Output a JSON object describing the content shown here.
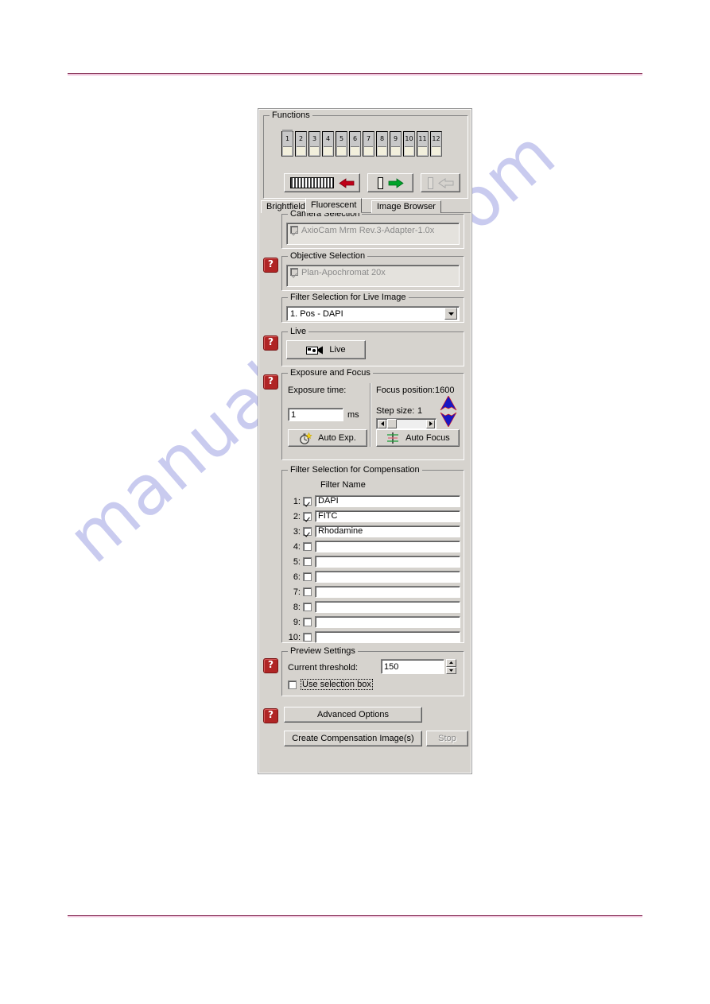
{
  "page": {
    "watermark": "manualshive.com",
    "rule_color": "#8c3a5e"
  },
  "window": {
    "functions": {
      "title": "Functions",
      "buttons": [
        "1",
        "2",
        "3",
        "4",
        "5",
        "6",
        "7",
        "8",
        "9",
        "10",
        "11",
        "12"
      ],
      "toolbar": [
        {
          "name": "load-rack-button",
          "icon": "rack-with-red-left-arrow",
          "enabled": true
        },
        {
          "name": "load-slide-button",
          "icon": "slide-with-green-right-arrow",
          "enabled": true
        },
        {
          "name": "unload-slide-button",
          "icon": "slide-with-gray-left-arrow",
          "enabled": false
        }
      ]
    },
    "tabs": [
      {
        "label": "Brightfield",
        "active": false
      },
      {
        "label": "Fluorescent",
        "active": true
      },
      {
        "label": "Image Browser",
        "active": false
      }
    ],
    "camera_selection": {
      "title": "Camera Selection",
      "item": "AxioCam Mrm Rev.3-Adapter-1.0x",
      "checked": true,
      "enabled": false
    },
    "objective_selection": {
      "title": "Objective Selection",
      "item": "Plan-Apochromat 20x",
      "checked": true,
      "enabled": false
    },
    "filter_live": {
      "title": "Filter Selection for Live Image",
      "value": "1. Pos - DAPI"
    },
    "live": {
      "title": "Live",
      "button_label": "Live",
      "button_icon": "video-camera-icon"
    },
    "exposure_focus": {
      "title": "Exposure and Focus",
      "exposure_label": "Exposure time:",
      "exposure_value": "1",
      "exposure_unit": "ms",
      "auto_exp_label": "Auto Exp.",
      "auto_exp_icon": "stopwatch-icon",
      "focus_position_label": "Focus position:",
      "focus_position_value": "1600",
      "step_size_label": "Step size:",
      "step_size_value": "1",
      "auto_focus_label": "Auto Focus",
      "auto_focus_icon": "crosshair-icon",
      "up_arrow_icon": "blue-up-arrow-icon",
      "down_arrow_icon": "blue-down-arrow-icon"
    },
    "filter_compensation": {
      "title": "Filter Selection for Compensation",
      "column_header": "Filter Name",
      "rows": [
        {
          "index": "1:",
          "checked": true,
          "name": "DAPI"
        },
        {
          "index": "2:",
          "checked": true,
          "name": "FITC"
        },
        {
          "index": "3:",
          "checked": true,
          "name": "Rhodamine"
        },
        {
          "index": "4:",
          "checked": false,
          "name": ""
        },
        {
          "index": "5:",
          "checked": false,
          "name": ""
        },
        {
          "index": "6:",
          "checked": false,
          "name": ""
        },
        {
          "index": "7:",
          "checked": false,
          "name": ""
        },
        {
          "index": "8:",
          "checked": false,
          "name": ""
        },
        {
          "index": "9:",
          "checked": false,
          "name": ""
        },
        {
          "index": "10:",
          "checked": false,
          "name": ""
        }
      ]
    },
    "preview_settings": {
      "title": "Preview Settings",
      "threshold_label": "Current threshold:",
      "threshold_value": "150",
      "selection_box_label": "Use selection box",
      "selection_box_checked": false
    },
    "actions": {
      "advanced_options": "Advanced Options",
      "create_compensation": "Create Compensation Image(s)",
      "stop": "Stop",
      "stop_enabled": false
    },
    "help_icon_glyph": "?"
  }
}
